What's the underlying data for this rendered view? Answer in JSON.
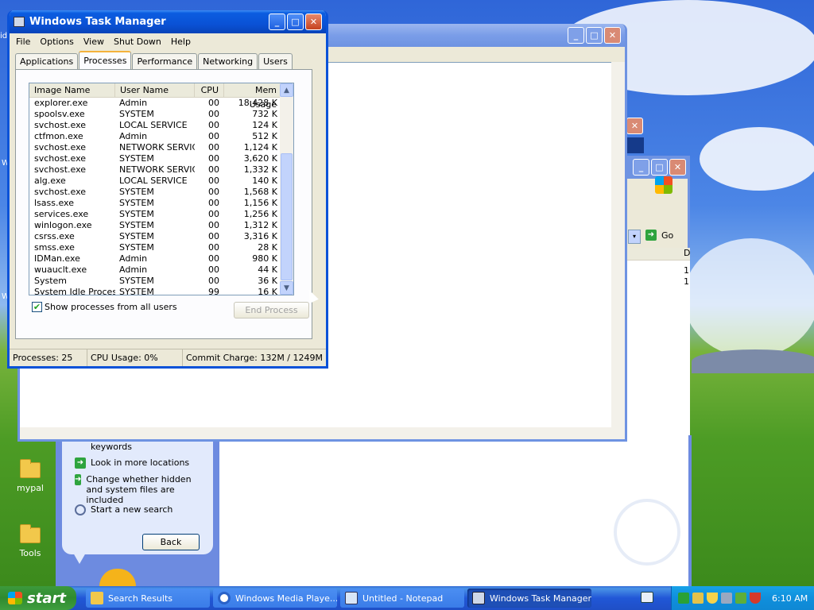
{
  "task_manager": {
    "title": "Windows Task Manager",
    "menu": [
      "File",
      "Options",
      "View",
      "Shut Down",
      "Help"
    ],
    "tabs": [
      "Applications",
      "Processes",
      "Performance",
      "Networking",
      "Users"
    ],
    "active_tab": "Processes",
    "columns": [
      "Image Name",
      "User Name",
      "CPU",
      "Mem Usage"
    ],
    "processes": [
      {
        "name": "explorer.exe",
        "user": "Admin",
        "cpu": "00",
        "mem": "18,428 K"
      },
      {
        "name": "spoolsv.exe",
        "user": "SYSTEM",
        "cpu": "00",
        "mem": "732 K"
      },
      {
        "name": "svchost.exe",
        "user": "LOCAL SERVICE",
        "cpu": "00",
        "mem": "124 K"
      },
      {
        "name": "ctfmon.exe",
        "user": "Admin",
        "cpu": "00",
        "mem": "512 K"
      },
      {
        "name": "svchost.exe",
        "user": "NETWORK SERVICE",
        "cpu": "00",
        "mem": "1,124 K"
      },
      {
        "name": "svchost.exe",
        "user": "SYSTEM",
        "cpu": "00",
        "mem": "3,620 K"
      },
      {
        "name": "svchost.exe",
        "user": "NETWORK SERVICE",
        "cpu": "00",
        "mem": "1,332 K"
      },
      {
        "name": "alg.exe",
        "user": "LOCAL SERVICE",
        "cpu": "00",
        "mem": "140 K"
      },
      {
        "name": "svchost.exe",
        "user": "SYSTEM",
        "cpu": "00",
        "mem": "1,568 K"
      },
      {
        "name": "lsass.exe",
        "user": "SYSTEM",
        "cpu": "00",
        "mem": "1,156 K"
      },
      {
        "name": "services.exe",
        "user": "SYSTEM",
        "cpu": "00",
        "mem": "1,256 K"
      },
      {
        "name": "winlogon.exe",
        "user": "SYSTEM",
        "cpu": "00",
        "mem": "1,312 K"
      },
      {
        "name": "csrss.exe",
        "user": "SYSTEM",
        "cpu": "00",
        "mem": "3,316 K"
      },
      {
        "name": "smss.exe",
        "user": "SYSTEM",
        "cpu": "00",
        "mem": "28 K"
      },
      {
        "name": "IDMan.exe",
        "user": "Admin",
        "cpu": "00",
        "mem": "980 K"
      },
      {
        "name": "wuauclt.exe",
        "user": "Admin",
        "cpu": "00",
        "mem": "44 K"
      },
      {
        "name": "System",
        "user": "SYSTEM",
        "cpu": "00",
        "mem": "36 K"
      },
      {
        "name": "System Idle Process",
        "user": "SYSTEM",
        "cpu": "99",
        "mem": "16 K"
      }
    ],
    "show_all_label": "Show processes from all users",
    "show_all_checked": true,
    "end_process_label": "End Process",
    "status": {
      "processes": "Processes: 25",
      "cpu": "CPU Usage: 0%",
      "commit": "Commit Charge: 132M / 1249M"
    }
  },
  "search_pane": {
    "keywords_text": "keywords",
    "links": [
      "Look in more locations",
      "Change whether hidden and system files are included",
      "Start a new search"
    ],
    "back_label": "Back",
    "go_label": "Go",
    "column_fragment": "D",
    "row_fragments": [
      "1",
      "1"
    ]
  },
  "desktop": {
    "icons": [
      {
        "label": "mypal"
      },
      {
        "label": "Tools"
      }
    ],
    "edge_fragments": [
      "id",
      "W",
      "W"
    ]
  },
  "taskbar": {
    "start_label": "start",
    "tasks": [
      {
        "label": "Search Results",
        "icon": "search-folder-icon",
        "active": false
      },
      {
        "label": "Windows Media Playe...",
        "icon": "media-player-icon",
        "active": false
      },
      {
        "label": "Untitled - Notepad",
        "icon": "notepad-icon",
        "active": false
      },
      {
        "label": "Windows Task Manager",
        "icon": "task-manager-icon",
        "active": true
      }
    ],
    "clock": "6:10 AM"
  },
  "colors": {
    "xp_blue": "#0a52d8",
    "start_green": "#3c9a3c",
    "tray_blue": "#0f8fdc"
  }
}
